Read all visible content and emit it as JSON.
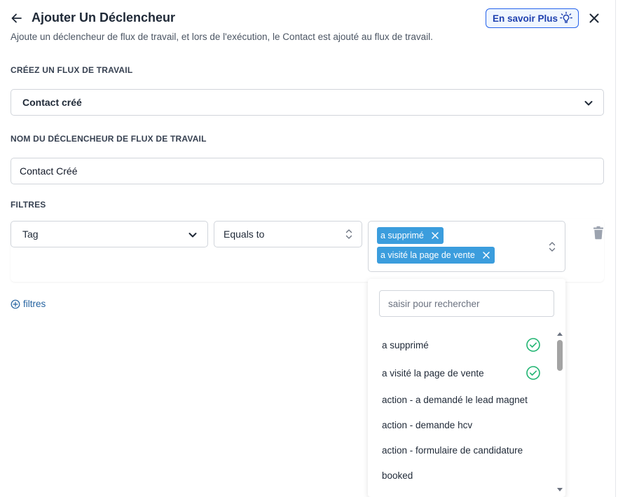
{
  "header": {
    "title": "Ajouter Un Déclencheur",
    "subtitle": "Ajoute un déclencheur de flux de travail, et lors de l'exécution, le Contact est ajouté au flux de travail.",
    "learn_more_label": "En savoir Plus"
  },
  "flow": {
    "label": "CRÉEZ UN FLUX DE TRAVAIL",
    "selected": "Contact créé"
  },
  "trigger_name": {
    "label": "NOM DU DÉCLENCHEUR DE FLUX DE TRAVAIL",
    "value": "Contact Créé"
  },
  "filters": {
    "label": "FILTRES",
    "field": "Tag",
    "operator": "Equals to",
    "selected_values": [
      "a supprimé",
      "a visité la page de vente"
    ],
    "add_label": "filtres"
  },
  "dropdown": {
    "search_placeholder": "saisir pour rechercher",
    "options": [
      {
        "label": "a supprimé",
        "checked": true
      },
      {
        "label": "a visité la page de vente",
        "checked": true
      },
      {
        "label": "action - a demandé le lead magnet",
        "checked": false
      },
      {
        "label": "action - demande hcv",
        "checked": false
      },
      {
        "label": "action - formulaire de candidature",
        "checked": false
      },
      {
        "label": "booked",
        "checked": false
      }
    ]
  },
  "colors": {
    "accent": "#2563eb",
    "chip": "#3b9ddd",
    "check": "#22b573"
  },
  "icons": [
    "back-arrow-icon",
    "lightbulb-icon",
    "close-icon",
    "chevron-down-icon",
    "up-down-icon",
    "trash-icon",
    "plus-circle-icon",
    "check-circle-icon"
  ]
}
